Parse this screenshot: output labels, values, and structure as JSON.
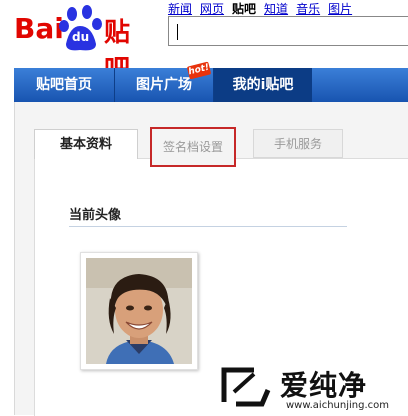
{
  "logo": {
    "text": "Bai",
    "paw_text": "du",
    "suffix": "贴吧"
  },
  "search_nav": [
    "新闻",
    "网页",
    "贴吧",
    "知道",
    "音乐",
    "图片"
  ],
  "search_nav_active": "贴吧",
  "search": {
    "value": ""
  },
  "nav": {
    "items": [
      "贴吧首页",
      "图片广场",
      "我的i贴吧"
    ],
    "active": "我的i贴吧",
    "hot_badge": "hot!"
  },
  "tabs": [
    "基本资料",
    "签名档设置",
    "手机服务"
  ],
  "section": {
    "title": "当前头像"
  },
  "watermark": {
    "text": "爱纯净",
    "url": "www.aichunjing.com"
  },
  "colors": {
    "baidu_red": "#e10601",
    "baidu_blue": "#2932e1",
    "nav_blue": "#1f60c0",
    "highlight_red": "#c62828"
  }
}
